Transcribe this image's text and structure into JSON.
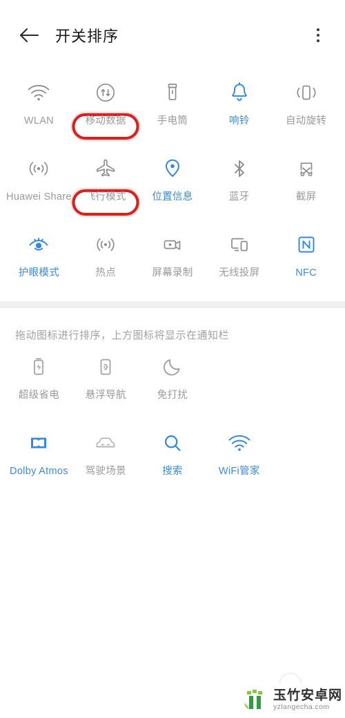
{
  "header": {
    "back_icon": "arrow-left-icon",
    "title": "开关排序",
    "more_icon": "more-vertical-icon"
  },
  "hint": {
    "text": "拖动图标进行排序，上方图标将显示在通知栏"
  },
  "colors": {
    "accent_blue": "#3c8ade",
    "inactive_gray": "#9a9a9a",
    "annotation_red": "#d92020",
    "divider": "#f0f0f0",
    "background": "#ffffff"
  },
  "top_section": {
    "rows": [
      [
        {
          "label": "WLAN",
          "icon": "wifi-icon",
          "state": "inactive",
          "highlighted": false
        },
        {
          "label": "移动数据",
          "icon": "mobile-data-icon",
          "state": "inactive",
          "highlighted": true
        },
        {
          "label": "手电筒",
          "icon": "flashlight-icon",
          "state": "inactive",
          "highlighted": false
        },
        {
          "label": "响铃",
          "icon": "bell-icon",
          "state": "active",
          "highlighted": false
        },
        {
          "label": "自动旋转",
          "icon": "auto-rotate-icon",
          "state": "inactive",
          "highlighted": false
        }
      ],
      [
        {
          "label": "Huawei Share",
          "icon": "huawei-share-icon",
          "state": "inactive",
          "highlighted": false
        },
        {
          "label": "飞行模式",
          "icon": "airplane-icon",
          "state": "inactive",
          "highlighted": true
        },
        {
          "label": "位置信息",
          "icon": "location-pin-icon",
          "state": "active",
          "highlighted": false
        },
        {
          "label": "蓝牙",
          "icon": "bluetooth-icon",
          "state": "inactive",
          "highlighted": false
        },
        {
          "label": "截屏",
          "icon": "screenshot-icon",
          "state": "inactive",
          "highlighted": false
        }
      ],
      [
        {
          "label": "护眼模式",
          "icon": "eye-comfort-icon",
          "state": "active",
          "highlighted": false
        },
        {
          "label": "热点",
          "icon": "hotspot-icon",
          "state": "inactive",
          "highlighted": false
        },
        {
          "label": "屏幕录制",
          "icon": "screen-record-icon",
          "state": "inactive",
          "highlighted": false
        },
        {
          "label": "无线投屏",
          "icon": "cast-icon",
          "state": "inactive",
          "highlighted": false
        },
        {
          "label": "NFC",
          "icon": "nfc-icon",
          "state": "active",
          "highlighted": false
        }
      ]
    ]
  },
  "bottom_section": {
    "rows": [
      [
        {
          "label": "超级省电",
          "icon": "battery-saver-icon",
          "state": "inactive",
          "highlighted": false
        },
        {
          "label": "悬浮导航",
          "icon": "floating-nav-icon",
          "state": "inactive",
          "highlighted": false
        },
        {
          "label": "免打扰",
          "icon": "do-not-disturb-icon",
          "state": "inactive",
          "highlighted": false
        }
      ],
      [
        {
          "label": "Dolby Atmos",
          "icon": "dolby-atmos-icon",
          "state": "active",
          "highlighted": false
        },
        {
          "label": "驾驶场景",
          "icon": "car-icon",
          "state": "inactive",
          "highlighted": false
        },
        {
          "label": "搜索",
          "icon": "search-icon",
          "state": "active",
          "highlighted": false
        },
        {
          "label": "WiFi管家",
          "icon": "wifi-manager-icon",
          "state": "active",
          "highlighted": false
        }
      ]
    ]
  },
  "watermark": {
    "title": "玉竹安卓网",
    "url": "yzlangecha.com",
    "logo_icon": "bamboo-logo-icon"
  }
}
